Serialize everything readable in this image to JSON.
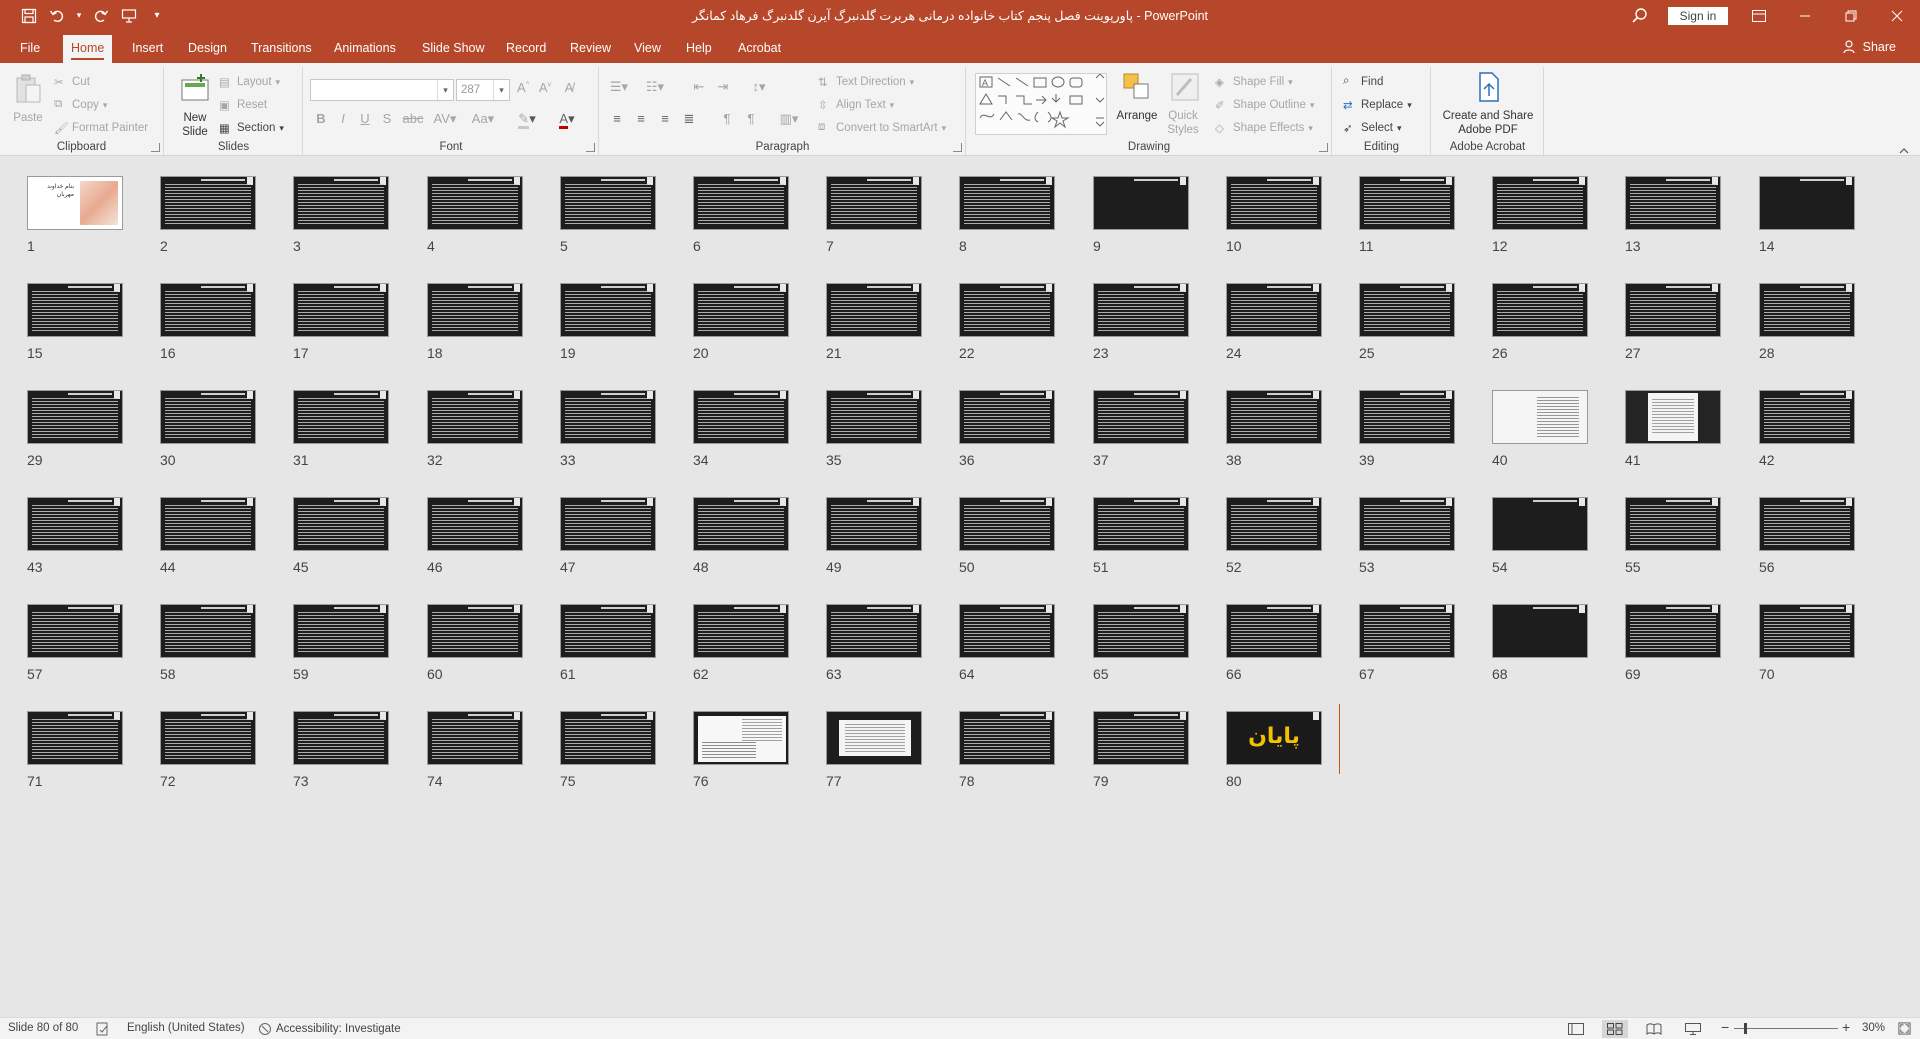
{
  "window": {
    "title": "پاورپوینت فصل پنجم کتاب خانواده درمانی هربرت گلدنبرگ آیرن گلدنبرگ فرهاد کمانگر  -  PowerPoint",
    "sign_in": "Sign in"
  },
  "tabs": [
    "File",
    "Home",
    "Insert",
    "Design",
    "Transitions",
    "Animations",
    "Slide Show",
    "Record",
    "Review",
    "View",
    "Help",
    "Acrobat"
  ],
  "active_tab": "Home",
  "share_label": "Share",
  "ribbon": {
    "clipboard": {
      "label": "Clipboard",
      "paste": "Paste",
      "cut": "Cut",
      "copy": "Copy",
      "format_painter": "Format Painter"
    },
    "slides": {
      "label": "Slides",
      "new_slide": "New Slide",
      "layout": "Layout",
      "reset": "Reset",
      "section": "Section"
    },
    "font": {
      "label": "Font",
      "font_name": "",
      "font_size": "287"
    },
    "paragraph": {
      "label": "Paragraph",
      "text_direction": "Text Direction",
      "align_text": "Align Text",
      "convert_smartart": "Convert to SmartArt"
    },
    "drawing": {
      "label": "Drawing",
      "arrange": "Arrange",
      "quick_styles": "Quick Styles",
      "shape_fill": "Shape Fill",
      "shape_outline": "Shape Outline",
      "shape_effects": "Shape Effects"
    },
    "editing": {
      "label": "Editing",
      "find": "Find",
      "replace": "Replace",
      "select": "Select"
    },
    "acrobat": {
      "label": "Adobe Acrobat",
      "create_share_1": "Create and Share",
      "create_share_2": "Adobe PDF"
    }
  },
  "slides": {
    "count": 80,
    "cover_title": "بنام خداوند مهربان",
    "end_text": "پایان",
    "light_slides": [
      40
    ],
    "midpanel_slides": [
      41
    ],
    "panelfull_slides": [
      76
    ],
    "panelwide_slides": [
      77
    ],
    "plain_slides": [
      9,
      14,
      54,
      68
    ]
  },
  "status": {
    "slide_of": "Slide 80 of 80",
    "language": "English (United States)",
    "accessibility": "Accessibility: Investigate",
    "zoom": "30%"
  },
  "colors": {
    "accent": "#b7472a",
    "end_text": "#f2c200"
  }
}
